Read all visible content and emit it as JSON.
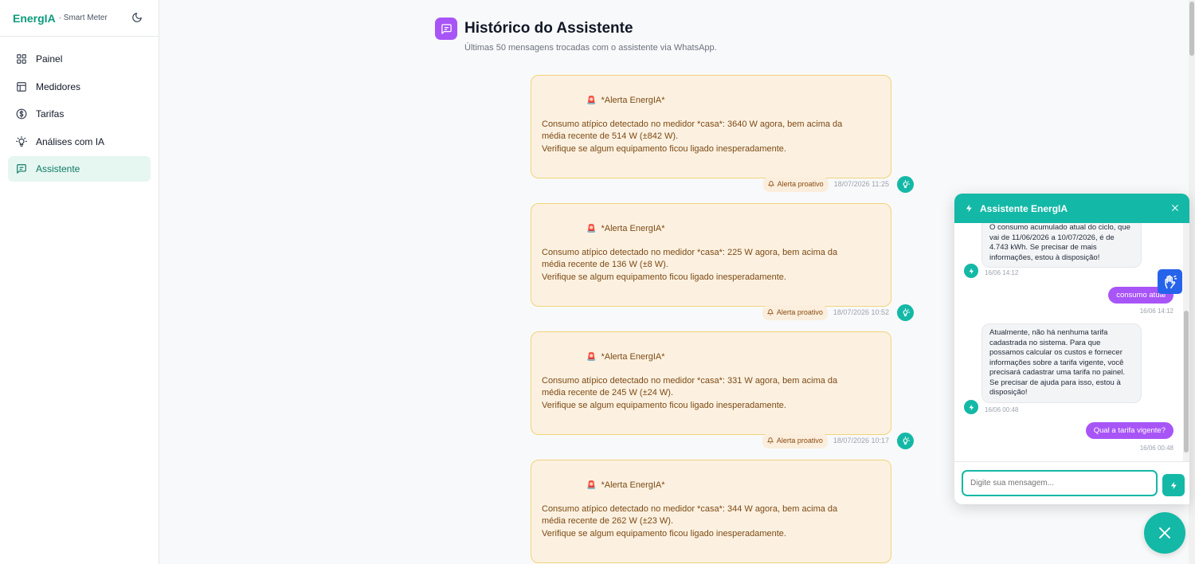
{
  "brand": {
    "name": "EnergIA",
    "subtitle": "· Smart Meter"
  },
  "sidebar": {
    "items": [
      {
        "label": "Painel",
        "icon": "grid-icon"
      },
      {
        "label": "Medidores",
        "icon": "table-icon"
      },
      {
        "label": "Tarifas",
        "icon": "dollar-circle-icon"
      },
      {
        "label": "Análises com IA",
        "icon": "lightbulb-icon"
      },
      {
        "label": "Assistente",
        "icon": "chat-icon",
        "active": true
      }
    ]
  },
  "page": {
    "title": "Histórico do Assistente",
    "subtitle": "Últimas 50 mensagens trocadas com o assistente via WhatsApp."
  },
  "messages": [
    {
      "title": "*Alerta EnergIA*",
      "line1": "Consumo atípico detectado no medidor *casa*: 3640 W agora, bem acima da",
      "line2": "média recente de 514 W (±842 W).",
      "line3": "Verifique se algum equipamento ficou ligado inesperadamente.",
      "badge": "Alerta proativo",
      "time": "18/07/2026 11:25"
    },
    {
      "title": "*Alerta EnergIA*",
      "line1": "Consumo atípico detectado no medidor *casa*: 225 W agora, bem acima da",
      "line2": "média recente de 136 W (±8 W).",
      "line3": "Verifique se algum equipamento ficou ligado inesperadamente.",
      "badge": "Alerta proativo",
      "time": "18/07/2026 10:52"
    },
    {
      "title": "*Alerta EnergIA*",
      "line1": "Consumo atípico detectado no medidor *casa*: 331 W agora, bem acima da",
      "line2": "média recente de 245 W (±24 W).",
      "line3": "Verifique se algum equipamento ficou ligado inesperadamente.",
      "badge": "Alerta proativo",
      "time": "18/07/2026 10:17"
    },
    {
      "title": "*Alerta EnergIA*",
      "line1": "Consumo atípico detectado no medidor *casa*: 344 W agora, bem acima da",
      "line2": "média recente de 262 W (±23 W).",
      "line3": "Verifique se algum equipamento ficou ligado inesperadamente."
    }
  ],
  "chat": {
    "title": "Assistente EnergIA",
    "messages": [
      {
        "from": "bot",
        "text": "O consumo acumulado atual do ciclo, que vai de 11/06/2026 a 10/07/2026, é de 4.743 kWh. Se precisar de mais informações, estou à disposição!",
        "time": "16/06 14:12"
      },
      {
        "from": "user",
        "text": "consumo atual",
        "time": "16/06 14:12"
      },
      {
        "from": "bot",
        "text": "Atualmente, não há nenhuma tarifa cadastrada no sistema. Para que possamos calcular os custos e fornecer informações sobre a tarifa vigente, você precisará cadastrar uma tarifa no painel. Se precisar de ajuda para isso, estou à disposição!",
        "time": "16/06 00:48"
      },
      {
        "from": "user",
        "text": "Qual a tarifa vigente?",
        "time": "16/06 00:48"
      }
    ],
    "input_placeholder": "Digite sua mensagem..."
  },
  "colors": {
    "accent": "#14b8a6",
    "brand": "#0d9b7e",
    "purple": "#a855f7",
    "alert_bg": "#fcf1e1",
    "alert_border": "#f2d37a"
  }
}
